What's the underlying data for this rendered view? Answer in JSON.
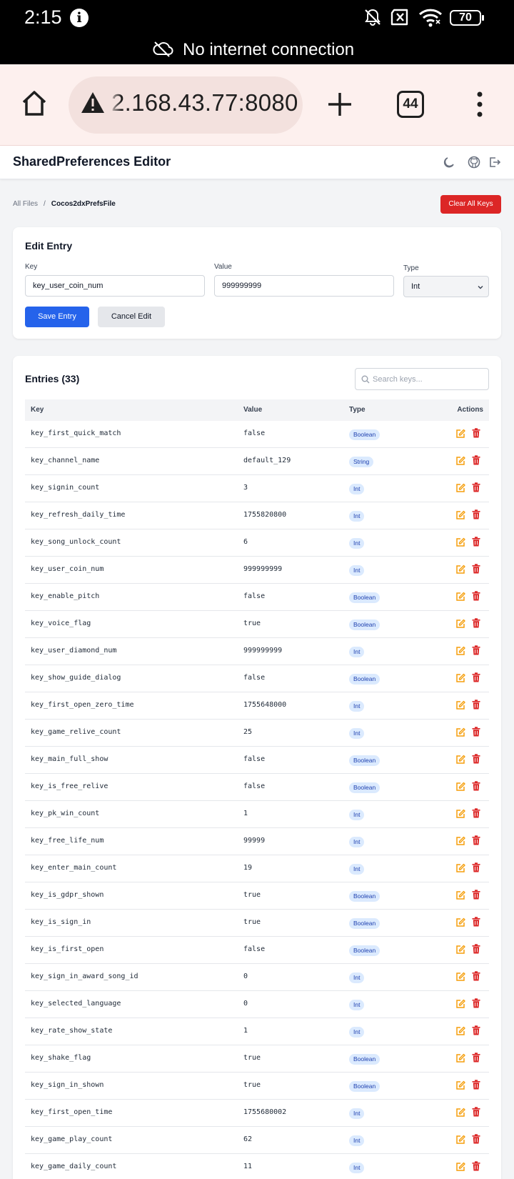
{
  "status_bar": {
    "time": "2:15",
    "battery": "70"
  },
  "offline_banner": {
    "text": "No internet connection"
  },
  "browser": {
    "url": "2.168.43.77:8080",
    "tab_count": "44"
  },
  "app": {
    "title": "SharedPreferences Editor"
  },
  "breadcrumb": {
    "root": "All Files",
    "separator": "/",
    "current": "Cocos2dxPrefsFile"
  },
  "clear_button": "Clear All Keys",
  "edit": {
    "title": "Edit Entry",
    "key_label": "Key",
    "key_value": "key_user_coin_num",
    "value_label": "Value",
    "value_value": "999999999",
    "type_label": "Type",
    "type_value": "Int",
    "save_label": "Save Entry",
    "cancel_label": "Cancel Edit"
  },
  "entries": {
    "title": "Entries (33)",
    "search_placeholder": "Search keys...",
    "columns": {
      "key": "Key",
      "value": "Value",
      "type": "Type",
      "actions": "Actions"
    },
    "rows": [
      {
        "key": "key_first_quick_match",
        "value": "false",
        "type": "Boolean"
      },
      {
        "key": "key_channel_name",
        "value": "default_129",
        "type": "String"
      },
      {
        "key": "key_signin_count",
        "value": "3",
        "type": "Int"
      },
      {
        "key": "key_refresh_daily_time",
        "value": "1755820800",
        "type": "Int"
      },
      {
        "key": "key_song_unlock_count",
        "value": "6",
        "type": "Int"
      },
      {
        "key": "key_user_coin_num",
        "value": "999999999",
        "type": "Int"
      },
      {
        "key": "key_enable_pitch",
        "value": "false",
        "type": "Boolean"
      },
      {
        "key": "key_voice_flag",
        "value": "true",
        "type": "Boolean"
      },
      {
        "key": "key_user_diamond_num",
        "value": "999999999",
        "type": "Int"
      },
      {
        "key": "key_show_guide_dialog",
        "value": "false",
        "type": "Boolean"
      },
      {
        "key": "key_first_open_zero_time",
        "value": "1755648000",
        "type": "Int"
      },
      {
        "key": "key_game_relive_count",
        "value": "25",
        "type": "Int"
      },
      {
        "key": "key_main_full_show",
        "value": "false",
        "type": "Boolean"
      },
      {
        "key": "key_is_free_relive",
        "value": "false",
        "type": "Boolean"
      },
      {
        "key": "key_pk_win_count",
        "value": "1",
        "type": "Int"
      },
      {
        "key": "key_free_life_num",
        "value": "99999",
        "type": "Int"
      },
      {
        "key": "key_enter_main_count",
        "value": "19",
        "type": "Int"
      },
      {
        "key": "key_is_gdpr_shown",
        "value": "true",
        "type": "Boolean"
      },
      {
        "key": "key_is_sign_in",
        "value": "true",
        "type": "Boolean"
      },
      {
        "key": "key_is_first_open",
        "value": "false",
        "type": "Boolean"
      },
      {
        "key": "key_sign_in_award_song_id",
        "value": "0",
        "type": "Int"
      },
      {
        "key": "key_selected_language",
        "value": "0",
        "type": "Int"
      },
      {
        "key": "key_rate_show_state",
        "value": "1",
        "type": "Int"
      },
      {
        "key": "key_shake_flag",
        "value": "true",
        "type": "Boolean"
      },
      {
        "key": "key_sign_in_shown",
        "value": "true",
        "type": "Boolean"
      },
      {
        "key": "key_first_open_time",
        "value": "1755680002",
        "type": "Int"
      },
      {
        "key": "key_game_play_count",
        "value": "62",
        "type": "Int"
      },
      {
        "key": "key_game_daily_count",
        "value": "11",
        "type": "Int"
      }
    ]
  },
  "icons": {
    "edit": "pencil-square-icon",
    "delete": "trash-icon",
    "theme": "moon-icon",
    "github": "github-icon",
    "logout": "logout-icon"
  },
  "colors": {
    "primary": "#2563eb",
    "danger": "#dc2626",
    "edit_icon": "#f59e0b",
    "badge_bg": "#dbeafe"
  }
}
